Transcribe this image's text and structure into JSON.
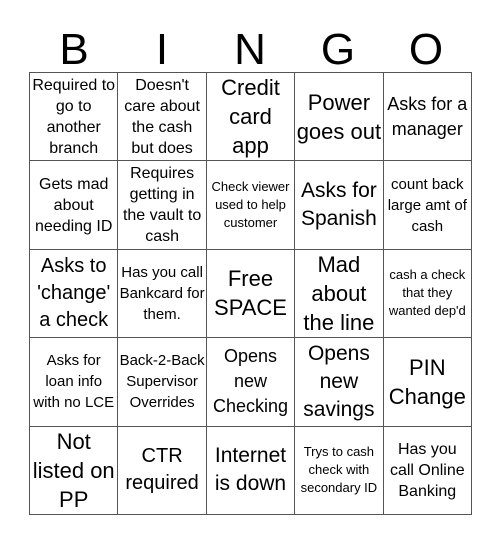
{
  "header": [
    "B",
    "I",
    "N",
    "G",
    "O"
  ],
  "cells": [
    [
      "Required to go to another branch",
      "Doesn't care about the cash but does",
      "Credit card app",
      "Power goes out",
      "Asks for a manager"
    ],
    [
      "Gets mad about needing ID",
      "Requires getting in the vault to cash",
      "Check viewer used to help customer",
      "Asks for Spanish",
      "count back large amt of cash"
    ],
    [
      "Asks to 'change' a check",
      "Has you call Bankcard for them.",
      "Free SPACE",
      "Mad about the line",
      "cash a check that they wanted dep'd"
    ],
    [
      "Asks for loan info with no LCE",
      "Back-2-Back Supervisor Overrides",
      "Opens new Checking",
      "Opens new savings",
      "PIN Change"
    ],
    [
      "Not listed on PP",
      "CTR required",
      "Internet is down",
      "Trys to cash check with secondary ID",
      "Has you call Online Banking"
    ]
  ]
}
